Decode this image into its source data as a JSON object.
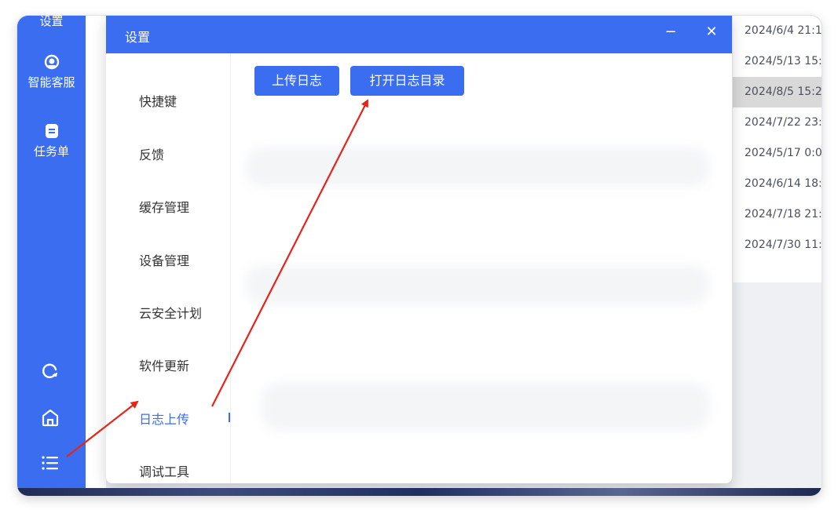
{
  "sidebar": {
    "top_partial_label": "设置",
    "items": [
      {
        "label": "智能客服",
        "icon": "headset-icon"
      },
      {
        "label": "任务单",
        "icon": "task-list-icon"
      }
    ],
    "bottom_icons": [
      "refresh-icon",
      "home-icon",
      "menu-list-icon"
    ]
  },
  "dialog": {
    "title": "设置",
    "minimize_glyph": "−",
    "close_glyph": "✕",
    "nav": [
      {
        "label": "快捷键"
      },
      {
        "label": "反馈"
      },
      {
        "label": "缓存管理"
      },
      {
        "label": "设备管理"
      },
      {
        "label": "云安全计划"
      },
      {
        "label": "软件更新"
      },
      {
        "label": "日志上传",
        "active": true
      },
      {
        "label": "调试工具"
      }
    ],
    "buttons": {
      "upload_log": "上传日志",
      "open_log_dir": "打开日志目录"
    }
  },
  "background_list": {
    "rows": [
      "2024/6/4 21:1",
      "2024/5/13 15:",
      "2024/8/5 15:2",
      "2024/7/22 23:",
      "2024/5/17 0:0",
      "2024/6/14 18:",
      "2024/7/18 21:",
      "2024/7/30 11:"
    ],
    "selected_index": 2
  },
  "colors": {
    "accent": "#3a6df0",
    "annotation_arrow": "#e8231a"
  }
}
